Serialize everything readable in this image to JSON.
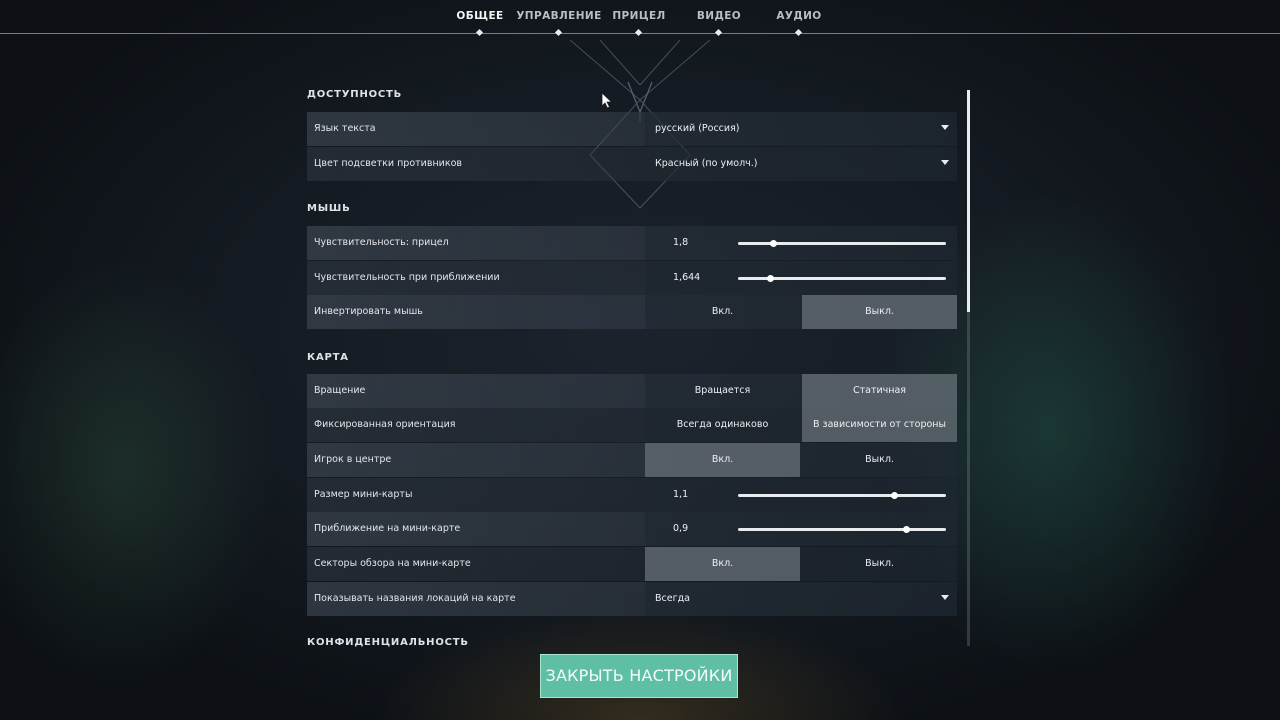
{
  "nav": {
    "tabs": [
      {
        "label": "ОБЩЕЕ",
        "active": true
      },
      {
        "label": "УПРАВЛЕНИЕ",
        "active": false
      },
      {
        "label": "ПРИЦЕЛ",
        "active": false
      },
      {
        "label": "ВИДЕО",
        "active": false
      },
      {
        "label": "АУДИО",
        "active": false
      }
    ]
  },
  "accessibility": {
    "title": "ДОСТУПНОСТЬ",
    "text_language": {
      "label": "Язык текста",
      "value": "русский (Россия)"
    },
    "enemy_highlight": {
      "label": "Цвет подсветки противников",
      "value": "Красный (по умолч.)"
    }
  },
  "mouse": {
    "title": "МЫШЬ",
    "sensitivity_aim": {
      "label": "Чувствительность: прицел",
      "value": "1,8",
      "level": 0.17
    },
    "sensitivity_zoom": {
      "label": "Чувствительность при приближении",
      "value": "1,644",
      "level": 0.155
    },
    "invert": {
      "label": "Инвертировать мышь",
      "on": "Вкл.",
      "off": "Выкл.",
      "selected": "off"
    }
  },
  "map": {
    "title": "КАРТА",
    "rotation": {
      "label": "Вращение",
      "left": "Вращается",
      "right": "Статичная",
      "selected": "right"
    },
    "fixed_orientation": {
      "label": "Фиксированная ориентация",
      "left": "Всегда одинаково",
      "right": "В зависимости от стороны",
      "selected": "right"
    },
    "player_centered": {
      "label": "Игрок в центре",
      "left": "Вкл.",
      "right": "Выкл.",
      "selected": "left"
    },
    "minimap_size": {
      "label": "Размер мини-карты",
      "value": "1,1",
      "level": 0.75
    },
    "minimap_zoom": {
      "label": "Приближение на мини-карте",
      "value": "0,9",
      "level": 0.81
    },
    "minimap_vision": {
      "label": "Секторы обзора на мини-карте",
      "left": "Вкл.",
      "right": "Выкл.",
      "selected": "left"
    },
    "location_names": {
      "label": "Показывать названия локаций на карте",
      "value": "Всегда"
    }
  },
  "privacy": {
    "title": "КОНФИДЕНЦИАЛЬНОСТЬ"
  },
  "close_button": {
    "label": "ЗАКРЫТЬ НАСТРОЙКИ"
  },
  "scroll": {
    "position": 0.0,
    "visible_fraction": 0.4
  },
  "colors": {
    "accent": "#5fbfa5",
    "background": "#141a21"
  }
}
